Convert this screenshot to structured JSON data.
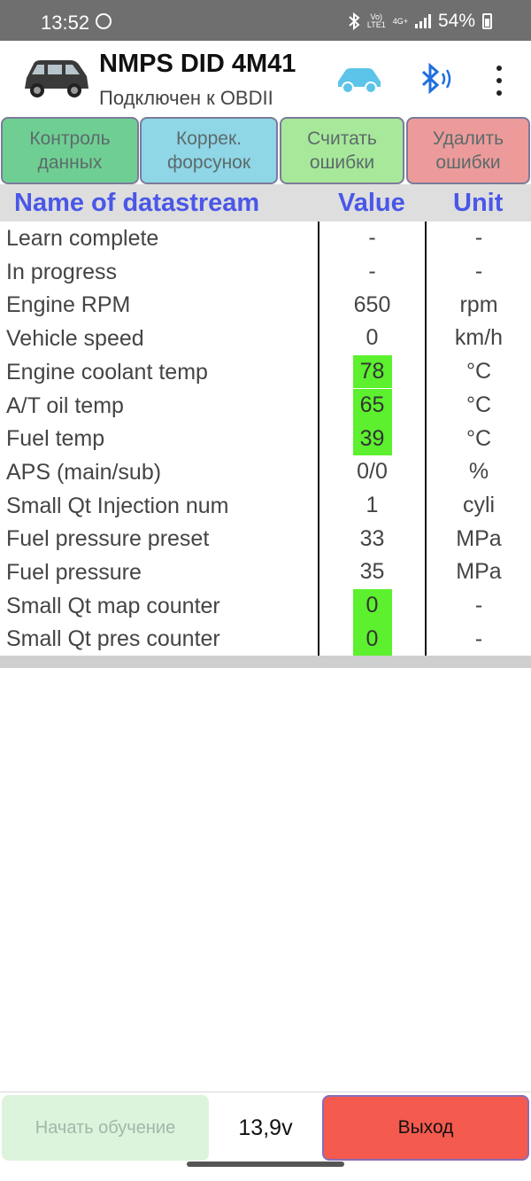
{
  "status_bar": {
    "time": "13:52",
    "network_top": "Vo)",
    "network_bottom": "LTE1",
    "net_type": "4G+",
    "battery": "54%"
  },
  "header": {
    "title": "NMPS DID 4M41",
    "subtitle": "Подключен к OBDII",
    "icons": [
      "car-photo-icon",
      "car-connected-icon",
      "bluetooth-icon",
      "more-vert-icon"
    ]
  },
  "actions": {
    "data_control_line1": "Контроль",
    "data_control_line2": "данных",
    "injector_corr_line1": "Коррек.",
    "injector_corr_line2": "форсунок",
    "read_errors_line1": "Считать",
    "read_errors_line2": "ошибки",
    "clear_errors_line1": "Удалить",
    "clear_errors_line2": "ошибки"
  },
  "table": {
    "headers": {
      "name": "Name of datastream",
      "value": "Value",
      "unit": "Unit"
    },
    "rows": [
      {
        "name": "Learn complete",
        "value": "-",
        "unit": "-",
        "highlight": false
      },
      {
        "name": "In progress",
        "value": "-",
        "unit": "-",
        "highlight": false
      },
      {
        "name": "Engine RPM",
        "value": "650",
        "unit": "rpm",
        "highlight": false
      },
      {
        "name": "Vehicle speed",
        "value": "0",
        "unit": "km/h",
        "highlight": false
      },
      {
        "name": "Engine coolant temp",
        "value": "78",
        "unit": "°C",
        "highlight": true
      },
      {
        "name": "A/T oil temp",
        "value": "65",
        "unit": "°C",
        "highlight": true
      },
      {
        "name": "Fuel temp",
        "value": "39",
        "unit": "°C",
        "highlight": true
      },
      {
        "name": "APS (main/sub)",
        "value": "0/0",
        "unit": "%",
        "highlight": false
      },
      {
        "name": "Small Qt Injection num",
        "value": "1",
        "unit": "cyli",
        "highlight": false
      },
      {
        "name": "Fuel pressure preset",
        "value": "33",
        "unit": "MPa",
        "highlight": false
      },
      {
        "name": "Fuel pressure",
        "value": "35",
        "unit": "MPa",
        "highlight": false
      },
      {
        "name": "Small Qt map counter",
        "value": "0",
        "unit": "-",
        "highlight": true
      },
      {
        "name": "Small Qt pres counter",
        "value": "0",
        "unit": "-",
        "highlight": true
      }
    ]
  },
  "bottom": {
    "learn_label": "Начать обучение",
    "voltage": "13,9v",
    "exit_label": "Выход"
  },
  "colors": {
    "highlight": "#5cf02e",
    "header_text": "#4a57e8",
    "exit_button": "#f55a4e"
  }
}
